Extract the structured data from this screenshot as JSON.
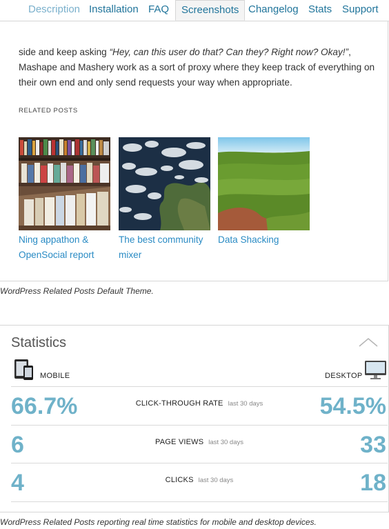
{
  "tabs": [
    {
      "label": "Description"
    },
    {
      "label": "Installation"
    },
    {
      "label": "FAQ"
    },
    {
      "label": "Screenshots"
    },
    {
      "label": "Changelog"
    },
    {
      "label": "Stats"
    },
    {
      "label": "Support"
    }
  ],
  "article": {
    "line1_a": "side and keep asking ",
    "line1_quote": "“Hey, can this user do that? Can they? Right now? Okay!”",
    "line1_b": ", Mashape and Mashery work as a sort of proxy where they keep track of everything on their own end and only send requests your way when appropriate."
  },
  "related_posts": {
    "heading": "RELATED POSTS",
    "items": [
      {
        "title": "Ning appathon & OpenSocial report"
      },
      {
        "title": "The best community mixer"
      },
      {
        "title": "Data Shacking"
      }
    ]
  },
  "caption1": "WordPress Related Posts Default Theme.",
  "statistics": {
    "title": "Statistics",
    "mobile_label": "MOBILE",
    "desktop_label": "DESKTOP",
    "rows": [
      {
        "mobile": "66.7%",
        "label": "CLICK-THROUGH RATE",
        "period": "last 30 days",
        "desktop": "54.5%"
      },
      {
        "mobile": "6",
        "label": "PAGE VIEWS",
        "period": "last 30 days",
        "desktop": "33"
      },
      {
        "mobile": "4",
        "label": "CLICKS",
        "period": "last 30 days",
        "desktop": "18"
      }
    ]
  },
  "caption2": "WordPress Related Posts reporting real time statistics for mobile and desktop devices.",
  "colors": {
    "link": "#2a8bc4",
    "tab": "#21759b",
    "stat_value": "#6fb2c9"
  },
  "icons": [
    "mobile-devices-icon",
    "desktop-monitor-icon",
    "collapse-chevron-up-icon"
  ]
}
